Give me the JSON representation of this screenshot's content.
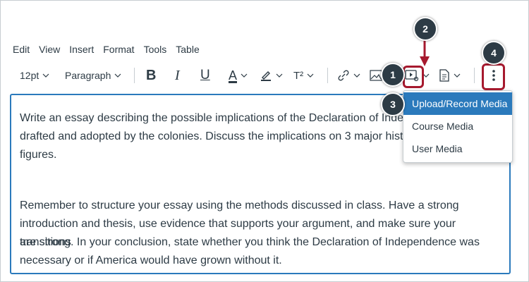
{
  "menu": [
    "Edit",
    "View",
    "Insert",
    "Format",
    "Tools",
    "Table"
  ],
  "toolbar": {
    "font_size": "12pt",
    "block_format": "Paragraph",
    "bold": "B",
    "italic": "I",
    "underline": "U",
    "text_color": "A",
    "superscript": "T²"
  },
  "editor": {
    "paragraph1_lines": [
      "Write an essay describing the possible implications of the Declaration of Indepe",
      "drafted and adopted by the colonies. Discuss the implications on 3 major histor",
      "figures."
    ],
    "paragraph2_lines": [
      "Remember to structure your essay using the methods discussed in class. Have a strong",
      "introduction and thesis, use evidence that supports your argument, and make sure your transitions",
      "are strong. In your conclusion, state whether you think the Declaration of Independence was",
      "necessary or if America would have grown without it."
    ]
  },
  "media_menu": {
    "items": [
      "Upload/Record Media",
      "Course Media",
      "User Media"
    ]
  },
  "callouts": [
    "1",
    "2",
    "3",
    "4"
  ],
  "colors": {
    "accent": "#2b7abc",
    "highlight": "#a6192e",
    "callout": "#2d3b45"
  }
}
